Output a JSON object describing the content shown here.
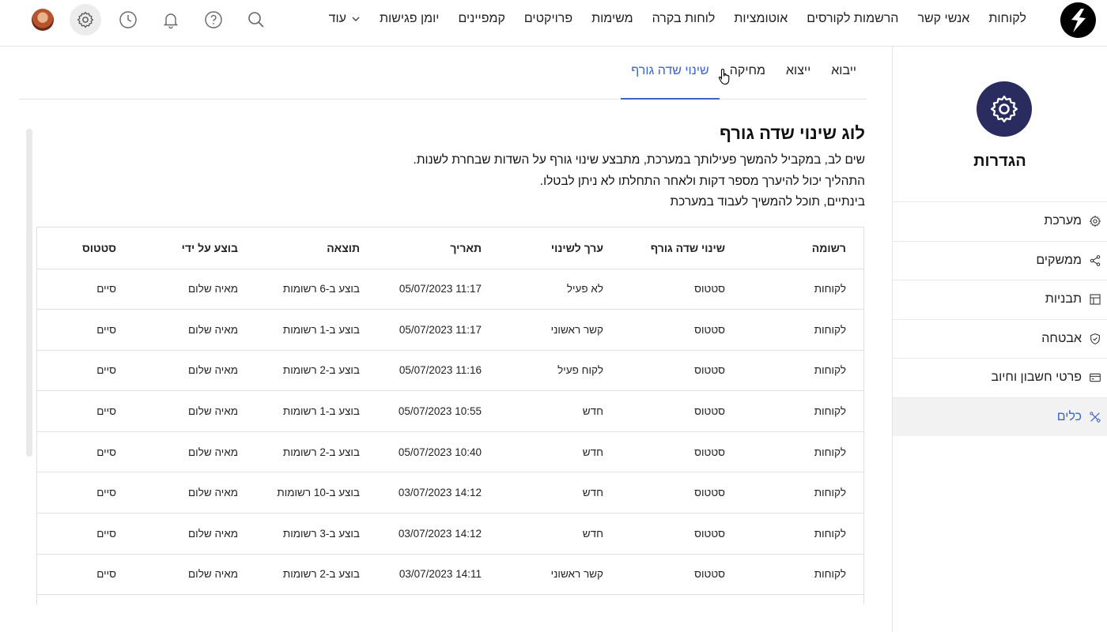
{
  "nav": {
    "items": [
      "לקוחות",
      "אנשי קשר",
      "הרשמות לקורסים",
      "אוטומציות",
      "לוחות בקרה",
      "משימות",
      "פרויקטים",
      "קמפיינים",
      "יומן פגישות"
    ],
    "more_label": "עוד"
  },
  "tabs": [
    "ייבוא",
    "ייצוא",
    "מחיקה",
    "שינוי שדה גורף"
  ],
  "active_tab": "שינוי שדה גורף",
  "sidebar": {
    "title": "הגדרות",
    "items": [
      {
        "label": "מערכת",
        "icon": "gear-icon"
      },
      {
        "label": "ממשקים",
        "icon": "share-icon"
      },
      {
        "label": "תבניות",
        "icon": "layout-icon"
      },
      {
        "label": "אבטחה",
        "icon": "shield-icon"
      },
      {
        "label": "פרטי חשבון וחיוב",
        "icon": "credit-card-icon"
      },
      {
        "label": "כלים",
        "icon": "tools-icon"
      }
    ],
    "active_item": "כלים"
  },
  "intro": {
    "title": "לוג שינוי שדה גורף",
    "lines": [
      "שים לב, במקביל להמשך פעילותך במערכת, מתבצע שינוי גורף על השדות שבחרת לשנות.",
      "התהליך יכול להיערך מספר דקות ולאחר התחלתו לא ניתן לבטלו.",
      "בינתיים, תוכל להמשיך לעבוד במערכת"
    ]
  },
  "table": {
    "headers": [
      "רשומה",
      "שינוי שדה גורף",
      "ערך לשינוי",
      "תאריך",
      "תוצאה",
      "בוצע על ידי",
      "סטטוס"
    ],
    "rows": [
      [
        "לקוחות",
        "סטטוס",
        "לא פעיל",
        "11:17 05/07/2023",
        "בוצע ב-6 רשומות",
        "מאיה שלום",
        "סיים"
      ],
      [
        "לקוחות",
        "סטטוס",
        "קשר ראשוני",
        "11:17 05/07/2023",
        "בוצע ב-1 רשומות",
        "מאיה שלום",
        "סיים"
      ],
      [
        "לקוחות",
        "סטטוס",
        "לקוח פעיל",
        "11:16 05/07/2023",
        "בוצע ב-2 רשומות",
        "מאיה שלום",
        "סיים"
      ],
      [
        "לקוחות",
        "סטטוס",
        "חדש",
        "10:55 05/07/2023",
        "בוצע ב-1 רשומות",
        "מאיה שלום",
        "סיים"
      ],
      [
        "לקוחות",
        "סטטוס",
        "חדש",
        "10:40 05/07/2023",
        "בוצע ב-2 רשומות",
        "מאיה שלום",
        "סיים"
      ],
      [
        "לקוחות",
        "סטטוס",
        "חדש",
        "14:12 03/07/2023",
        "בוצע ב-10 רשומות",
        "מאיה שלום",
        "סיים"
      ],
      [
        "לקוחות",
        "סטטוס",
        "חדש",
        "14:12 03/07/2023",
        "בוצע ב-3 רשומות",
        "מאיה שלום",
        "סיים"
      ],
      [
        "לקוחות",
        "סטטוס",
        "קשר ראשוני",
        "14:11 03/07/2023",
        "בוצע ב-2 רשומות",
        "מאיה שלום",
        "סיים"
      ]
    ]
  },
  "colors": {
    "accent": "#3d64c8",
    "settings_badge": "#2a2b5e",
    "logo": "#000000"
  }
}
